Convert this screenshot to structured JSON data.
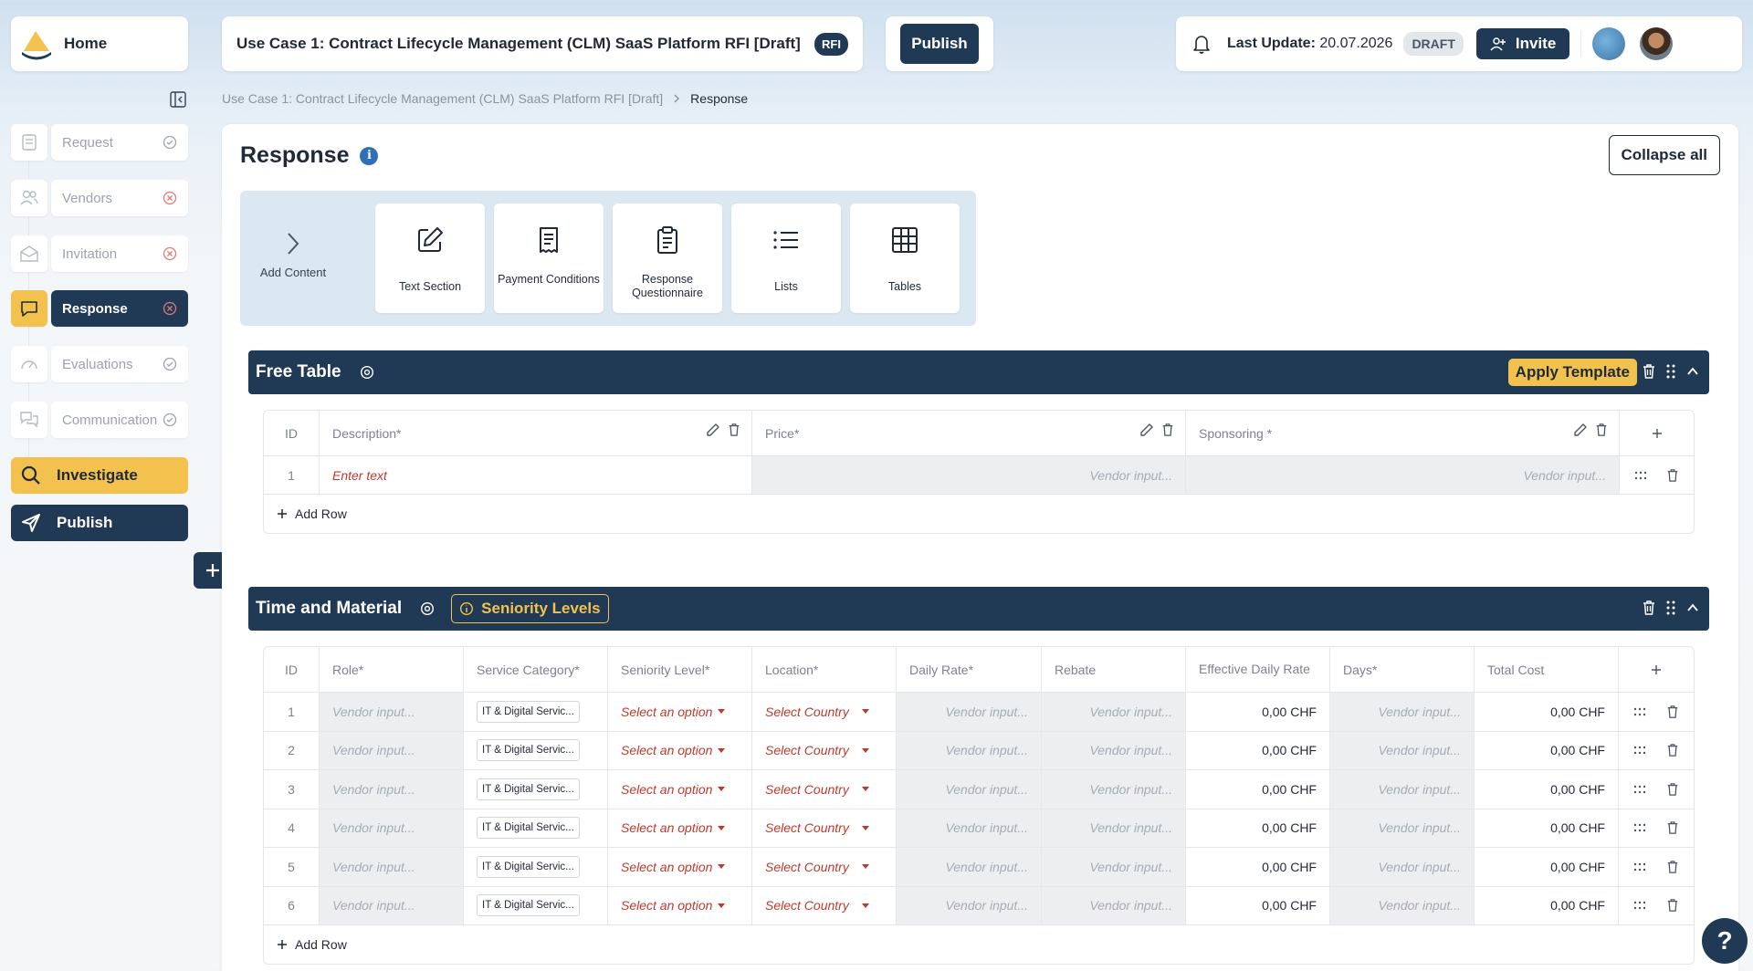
{
  "sidebar": {
    "home_label": "Home",
    "items": [
      {
        "label": "Request",
        "status": "done"
      },
      {
        "label": "Vendors",
        "status": "error"
      },
      {
        "label": "Invitation",
        "status": "error"
      },
      {
        "label": "Response",
        "status": "error"
      },
      {
        "label": "Evaluations",
        "status": "done"
      },
      {
        "label": "Communication",
        "status": "done"
      }
    ],
    "investigate_label": "Investigate",
    "publish_label": "Publish"
  },
  "header": {
    "title": "Use Case 1: Contract Lifecycle Management (CLM) SaaS Platform RFI [Draft]",
    "type_badge": "RFI",
    "publish_label": "Publish",
    "last_update_label": "Last Update:",
    "last_update_value": "20.07.2026",
    "status_badge": "DRAFT",
    "invite_label": "Invite"
  },
  "breadcrumb": {
    "parent": "Use Case 1: Contract Lifecycle Management (CLM) SaaS Platform RFI [Draft]",
    "current": "Response"
  },
  "main": {
    "title": "Response",
    "collapse_all_label": "Collapse all",
    "add_content_label": "Add Content",
    "content_tiles": [
      {
        "label": "Text Section",
        "icon": "edit-icon"
      },
      {
        "label": "Payment Conditions",
        "icon": "document-icon"
      },
      {
        "label": "Response Questionnaire",
        "icon": "clipboard-icon"
      },
      {
        "label": "Lists",
        "icon": "list-icon"
      },
      {
        "label": "Tables",
        "icon": "table-icon"
      }
    ]
  },
  "free_table": {
    "title": "Free Table",
    "apply_template_label": "Apply Template",
    "columns": [
      "ID",
      "Description*",
      "Price*",
      "Sponsoring *"
    ],
    "rows": [
      {
        "id": "1",
        "description": "Enter text",
        "price": "Vendor input...",
        "sponsoring": "Vendor input..."
      }
    ],
    "add_row_label": "Add Row"
  },
  "tm_table": {
    "title": "Time and Material",
    "seniority_badge": "Seniority Levels",
    "columns": [
      "ID",
      "Role*",
      "Service Category*",
      "Seniority Level*",
      "Location*",
      "Daily Rate*",
      "Rebate",
      "Effective Daily Rate",
      "Days*",
      "Total Cost"
    ],
    "row_ids": [
      "1",
      "2",
      "3",
      "4",
      "5",
      "6"
    ],
    "role_placeholder": "Vendor input...",
    "service_category": "IT & Digital Servic...",
    "seniority_placeholder": "Select an option",
    "location_placeholder": "Select Country",
    "daily_rate_placeholder": "Vendor input...",
    "rebate_placeholder": "Vendor input...",
    "effective_rate": "0,00 CHF",
    "days_placeholder": "Vendor input...",
    "total_cost": "0,00 CHF",
    "add_row_label": "Add Row"
  },
  "help_label": "?",
  "colors": {
    "navy": "#203a56",
    "accent_yellow": "#f2c14e",
    "error_red": "#c0392b",
    "info_blue": "#2f6fb8"
  }
}
